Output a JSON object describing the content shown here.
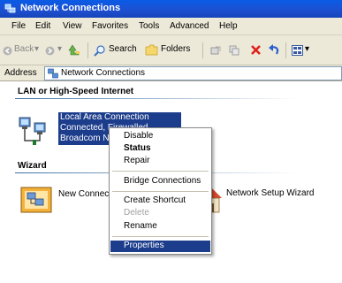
{
  "window": {
    "title": "Network Connections"
  },
  "menu": [
    "File",
    "Edit",
    "View",
    "Favorites",
    "Tools",
    "Advanced",
    "Help"
  ],
  "toolbar": {
    "back_label": "Back",
    "search_label": "Search",
    "folders_label": "Folders"
  },
  "address": {
    "label": "Address",
    "value": "Network Connections"
  },
  "groups": {
    "lan": "LAN or High-Speed Internet",
    "wizard": "Wizard"
  },
  "connection": {
    "name": "Local Area Connection",
    "status": "Connected, Firewalled",
    "device": "Broadcom Ne"
  },
  "wizard_items": {
    "new_connection": "New Connect",
    "network_setup": "Network Setup Wizard"
  },
  "context_menu": {
    "disable": "Disable",
    "status": "Status",
    "repair": "Repair",
    "bridge": "Bridge Connections",
    "create_shortcut": "Create Shortcut",
    "delete": "Delete",
    "rename": "Rename",
    "properties": "Properties"
  },
  "colors": {
    "title_bar": "#1d4fd0",
    "selection": "#1c3c8c",
    "chrome": "#ece9d8"
  }
}
